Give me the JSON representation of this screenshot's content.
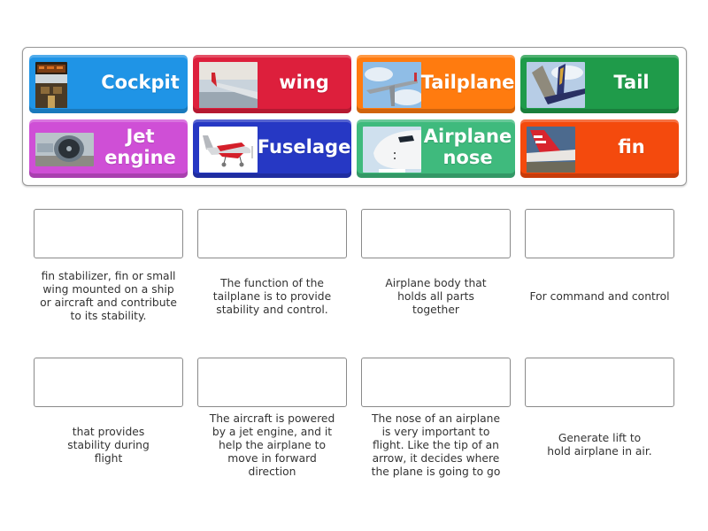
{
  "tiles": [
    {
      "label": "Cockpit",
      "color": "#1f94e6",
      "image": "cockpit-photo"
    },
    {
      "label": "wing",
      "color": "#dd1f3c",
      "image": "wing-photo"
    },
    {
      "label": "Tailplane",
      "color": "#ff7b0f",
      "image": "tailplane-photo"
    },
    {
      "label": "Tail",
      "color": "#1f9b4a",
      "image": "tail-photo"
    },
    {
      "label": "Jet engine",
      "color": "#cf4fd6",
      "image": "jet-engine-photo"
    },
    {
      "label": "Fuselage",
      "color": "#2638c4",
      "image": "fuselage-drawing"
    },
    {
      "label": "Airplane nose",
      "color": "#3fba7d",
      "image": "airplane-nose-photo"
    },
    {
      "label": "fin",
      "color": "#f44a0d",
      "image": "fin-photo"
    }
  ],
  "targets": [
    {
      "description": "fin stabilizer, fin or small wing mounted on a ship or aircraft and contribute to its stability."
    },
    {
      "description": "The function of the tailplane is to provide stability and control."
    },
    {
      "description": "Airplane body that holds all parts together"
    },
    {
      "description": "For command and control"
    },
    {
      "description": "that provides stability during flight"
    },
    {
      "description": "The aircraft is powered by a jet engine, and it help the airplane to move in forward direction"
    },
    {
      "description": "The nose of an airplane is very important to flight. Like the tip of an arrow, it decides where the plane is going to go"
    },
    {
      "description": "Generate lift to hold airplane in air."
    }
  ]
}
